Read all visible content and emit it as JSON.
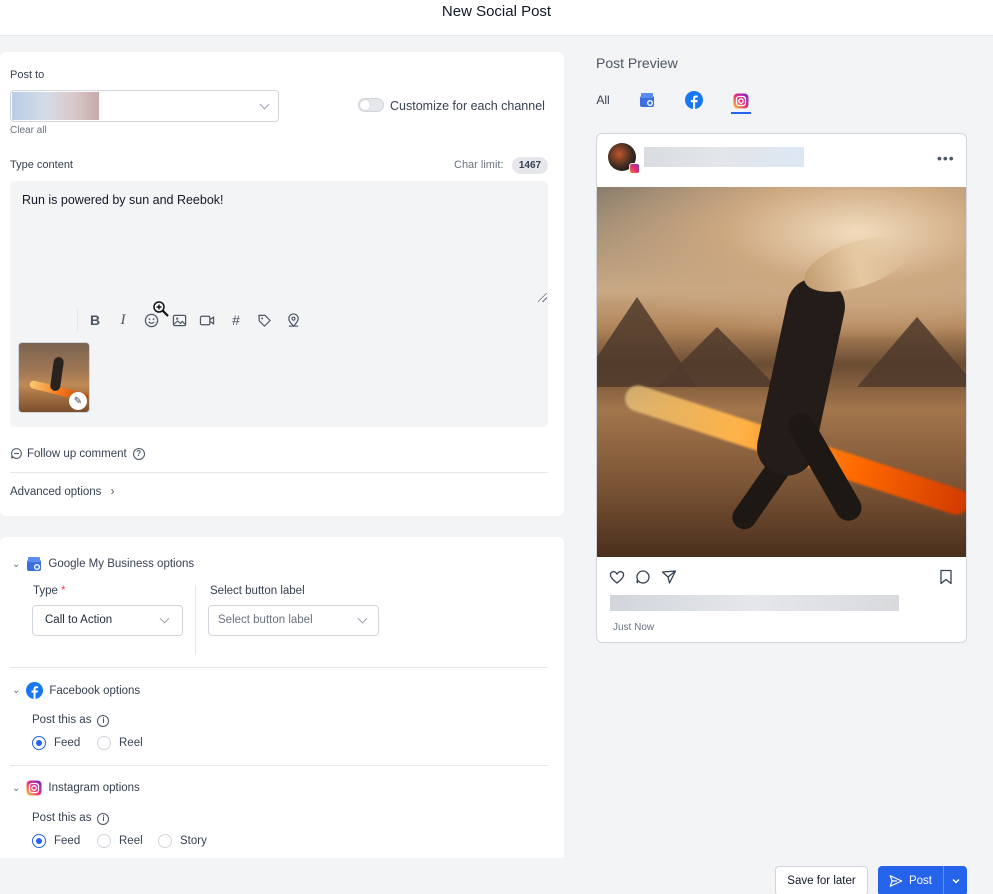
{
  "header": {
    "title": "New Social Post"
  },
  "post_to": {
    "label": "Post to",
    "clear_all": "Clear all",
    "customize_label": "Customize for each channel"
  },
  "content": {
    "label": "Type content",
    "char_limit_label": "Char limit:",
    "char_limit_value": "1467",
    "text": "Run is powered by sun and Reebok!"
  },
  "toolbar": {
    "bold": "B",
    "italic": "I",
    "hashtag": "#"
  },
  "follow_up": {
    "label": "Follow up comment"
  },
  "advanced": {
    "label": "Advanced options"
  },
  "gmb": {
    "title": "Google My Business options",
    "type_label": "Type",
    "type_value": "Call to Action",
    "button_label_label": "Select button label",
    "button_label_placeholder": "Select button label"
  },
  "facebook": {
    "title": "Facebook options",
    "post_as_label": "Post this as",
    "options": [
      "Feed",
      "Reel"
    ],
    "selected": "Feed"
  },
  "instagram": {
    "title": "Instagram options",
    "post_as_label": "Post this as",
    "options": [
      "Feed",
      "Reel",
      "Story"
    ],
    "selected": "Feed"
  },
  "preview": {
    "title": "Post Preview",
    "tabs": [
      "All",
      "google-my-business",
      "facebook",
      "instagram"
    ],
    "active_tab": "instagram",
    "timestamp": "Just Now"
  },
  "footer": {
    "save_label": "Save for later",
    "post_label": "Post"
  },
  "colors": {
    "primary": "#2563eb",
    "facebook": "#1877f2",
    "required": "#ef4444"
  }
}
